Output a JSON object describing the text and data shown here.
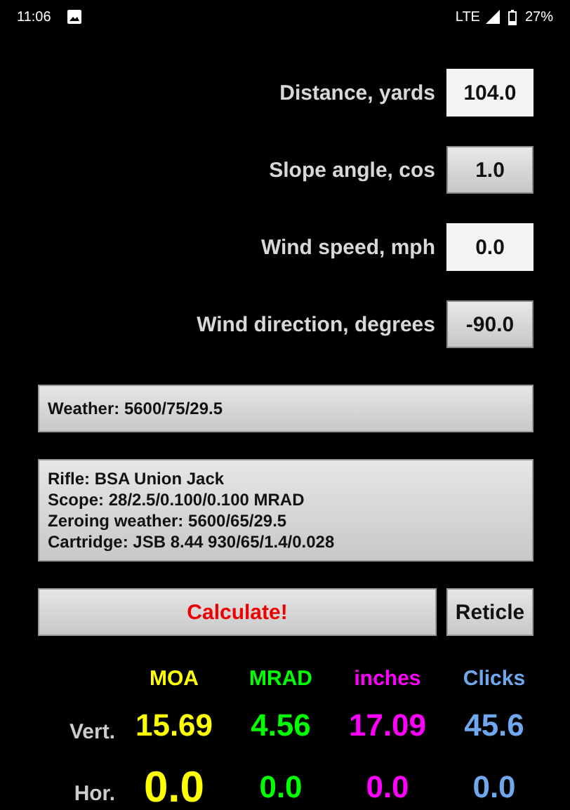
{
  "status_bar": {
    "time": "11:06",
    "network": "LTE",
    "battery": "27%"
  },
  "inputs": [
    {
      "label": "Distance, yards",
      "value": "104.0",
      "kind": "field"
    },
    {
      "label": "Slope angle, cos",
      "value": "1.0",
      "kind": "button"
    },
    {
      "label": "Wind speed, mph",
      "value": "0.0",
      "kind": "field"
    },
    {
      "label": "Wind direction, degrees",
      "value": "-90.0",
      "kind": "button"
    }
  ],
  "weather": "Weather: 5600/75/29.5",
  "profile": [
    "Rifle: BSA Union Jack",
    "Scope: 28/2.5/0.100/0.100 MRAD",
    "Zeroing weather: 5600/65/29.5",
    "Cartridge: JSB 8.44 930/65/1.4/0.028"
  ],
  "buttons": {
    "calculate": "Calculate!",
    "reticle": "Reticle"
  },
  "results": {
    "columns": [
      {
        "label": "MOA",
        "color": "#ffff00"
      },
      {
        "label": "MRAD",
        "color": "#00ff00"
      },
      {
        "label": "inches",
        "color": "#ff00ff"
      },
      {
        "label": "Clicks",
        "color": "#6fa8ee"
      }
    ],
    "rows": [
      {
        "label": "Vert.",
        "cells": [
          {
            "value": "15.69",
            "emphasis": false
          },
          {
            "value": "4.56",
            "emphasis": false
          },
          {
            "value": "17.09",
            "emphasis": false
          },
          {
            "value": "45.6",
            "emphasis": false
          }
        ]
      },
      {
        "label": "Hor.",
        "cells": [
          {
            "value": "0.0",
            "emphasis": true
          },
          {
            "value": "0.0",
            "emphasis": false
          },
          {
            "value": "0.0",
            "emphasis": false
          },
          {
            "value": "0.0",
            "emphasis": false
          }
        ]
      }
    ]
  }
}
